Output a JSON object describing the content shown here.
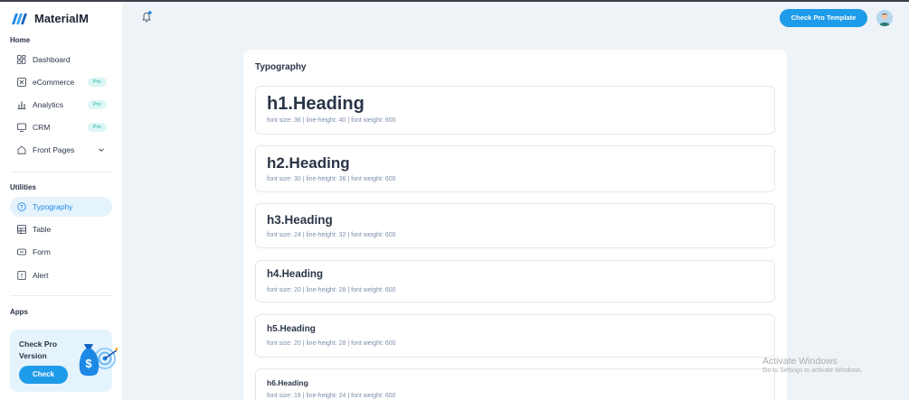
{
  "brand": {
    "name": "MaterialM"
  },
  "sidebar": {
    "sections": {
      "home": "Home",
      "utilities": "Utilities",
      "apps": "Apps"
    },
    "home_items": [
      {
        "label": "Dashboard",
        "icon": "dashboard-icon"
      },
      {
        "label": "eCommerce",
        "icon": "ecommerce-icon",
        "badge": "Pro"
      },
      {
        "label": "Analytics",
        "icon": "analytics-icon",
        "badge": "Pro"
      },
      {
        "label": "CRM",
        "icon": "crm-icon",
        "badge": "Pro"
      },
      {
        "label": "Front Pages",
        "icon": "front-pages-icon"
      }
    ],
    "utility_items": [
      {
        "label": "Typography",
        "icon": "typography-icon",
        "active": true
      },
      {
        "label": "Table",
        "icon": "table-icon"
      },
      {
        "label": "Form",
        "icon": "form-icon"
      },
      {
        "label": "Alert",
        "icon": "alert-icon"
      }
    ],
    "promo": {
      "title": "Check Pro Version",
      "button": "Check"
    }
  },
  "header": {
    "cta": "Check Pro Template"
  },
  "main": {
    "title": "Typography",
    "headings": [
      {
        "text": "h1.Heading",
        "meta": "font size: 36 | line-height: 40 | font weight: 600"
      },
      {
        "text": "h2.Heading",
        "meta": "font size: 30 | line-height: 36 | font weight: 600"
      },
      {
        "text": "h3.Heading",
        "meta": "font size: 24 | line-height: 32 | font weight: 600"
      },
      {
        "text": "h4.Heading",
        "meta": "font size: 20 | line-height: 28 | font weight: 600"
      },
      {
        "text": "h5.Heading",
        "meta": "font size: 20 | line-height: 28 | font weight: 600"
      },
      {
        "text": "h6.Heading",
        "meta": "font size: 16 | line-height: 24 | font weight: 600"
      }
    ]
  },
  "watermark": {
    "line1": "Activate Windows",
    "line2": "Go to Settings to activate Windows."
  },
  "colors": {
    "accent": "#1e9be9",
    "active_bg": "#e5f3fd",
    "page_bg": "#eef3f8",
    "pro_badge_bg": "#dcf6f4",
    "pro_badge_text": "#13b1a5"
  }
}
